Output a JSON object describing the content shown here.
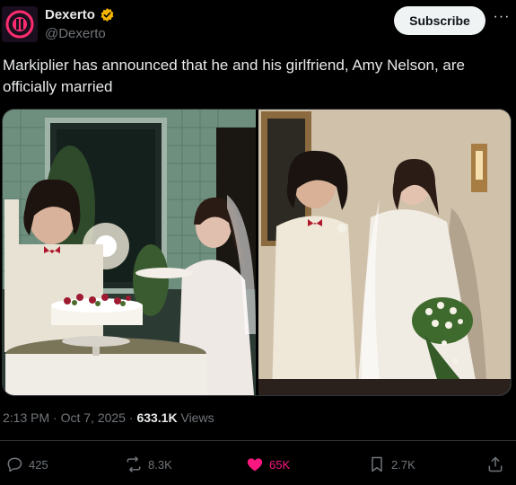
{
  "account": {
    "display_name": "Dexerto",
    "handle": "@Dexerto",
    "verified_icon": "verified-badge-icon",
    "verified_color": "#f4b400"
  },
  "header": {
    "subscribe_label": "Subscribe",
    "more_label": "···"
  },
  "tweet": {
    "text": "Markiplier has announced that he and his girlfriend, Amy Nelson, are officially married",
    "time": "2:13 PM",
    "separator": "·",
    "date": "Oct 7, 2025",
    "views_count": "633.1K",
    "views_label": "Views"
  },
  "actions": {
    "reply": {
      "icon": "reply-icon",
      "count": "425"
    },
    "repost": {
      "icon": "repost-icon",
      "count": "8.3K"
    },
    "like": {
      "icon": "heart-icon",
      "count": "65K",
      "color": "#f91880"
    },
    "bookmark": {
      "icon": "bookmark-icon",
      "count": "2.7K"
    },
    "share": {
      "icon": "share-icon"
    }
  },
  "colors": {
    "background": "#000000",
    "text": "#e7e9ea",
    "muted": "#71767b",
    "button_bg": "#eff3f4"
  }
}
